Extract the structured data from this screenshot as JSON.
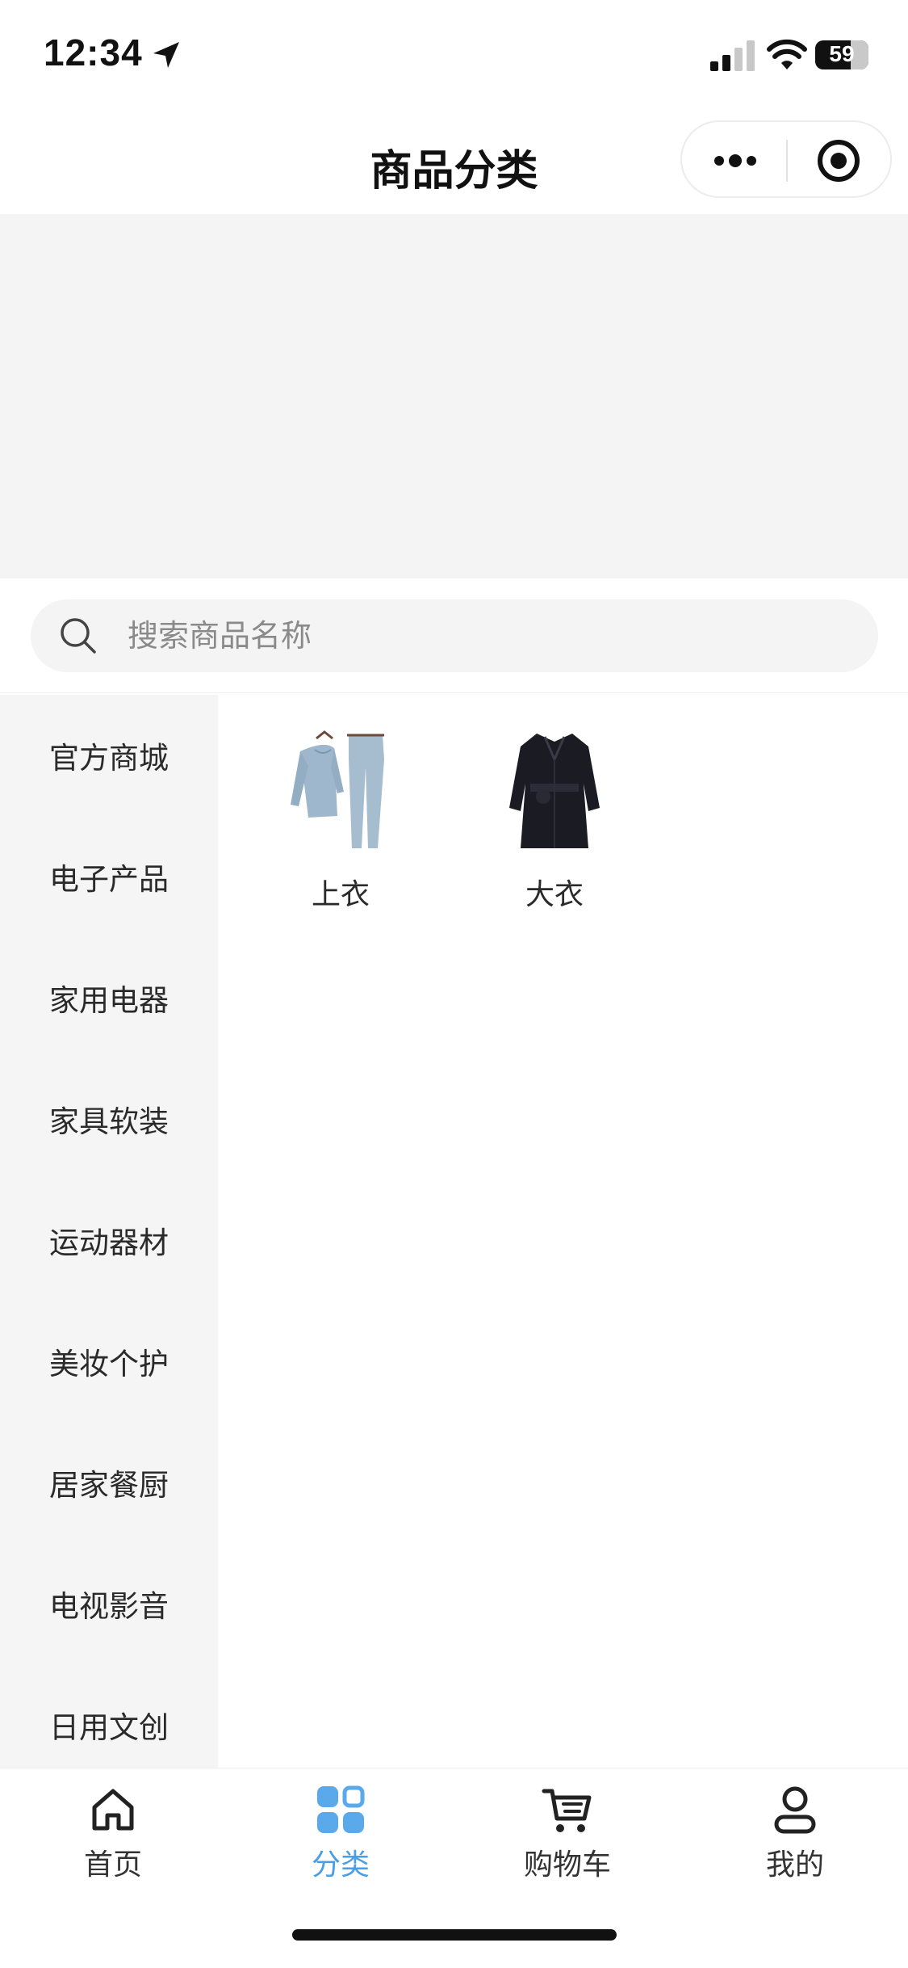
{
  "status_bar": {
    "time": "12:34",
    "battery": "59",
    "icons": [
      "location-arrow-icon",
      "signal-icon",
      "wifi-icon",
      "battery-icon"
    ]
  },
  "header": {
    "title": "商品分类",
    "capsule_icons": [
      "more-icon",
      "target-icon"
    ]
  },
  "search": {
    "placeholder": "搜索商品名称",
    "value": ""
  },
  "sidebar": {
    "items": [
      {
        "label": "官方商城"
      },
      {
        "label": "电子产品"
      },
      {
        "label": "家用电器"
      },
      {
        "label": "家具软装"
      },
      {
        "label": "运动器材"
      },
      {
        "label": "美妆个护"
      },
      {
        "label": "居家餐厨"
      },
      {
        "label": "电视影音"
      },
      {
        "label": "日用文创"
      }
    ]
  },
  "products": [
    {
      "label": "上衣",
      "image": "pajama-set-image"
    },
    {
      "label": "大衣",
      "image": "black-coat-image"
    }
  ],
  "tab_bar": {
    "tabs": [
      {
        "label": "首页",
        "icon": "home-icon",
        "active": false
      },
      {
        "label": "分类",
        "icon": "category-grid-icon",
        "active": true
      },
      {
        "label": "购物车",
        "icon": "cart-icon",
        "active": false
      },
      {
        "label": "我的",
        "icon": "user-icon",
        "active": false
      }
    ]
  },
  "colors": {
    "accent": "#4a9ee6",
    "sidebar_bg": "#f5f5f5",
    "banner_bg": "#f4f4f4"
  }
}
